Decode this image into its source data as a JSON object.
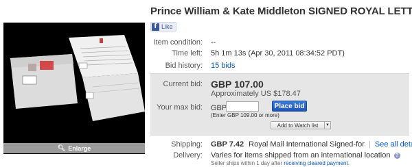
{
  "listing": {
    "title": "Prince William & Kate Middleton SIGNED ROYAL LETTER",
    "like_label": "Like",
    "like_icon": "facebook-icon"
  },
  "photo": {
    "enlarge_label": "Enlarge",
    "enlarge_icon": "magnifier-icon"
  },
  "details": {
    "item_condition_label": "Item condition:",
    "item_condition_value": "--",
    "time_left_label": "Time left:",
    "time_left_value": "5h 1m 13s (Apr 30, 2011 08:34:52 PDT)",
    "bid_history_label": "Bid history:",
    "bid_history_value": "15 bids"
  },
  "bidding": {
    "current_bid_label": "Current bid:",
    "current_bid_value": "GBP 107.00",
    "approx_value": "Approximately US $178.47",
    "max_bid_label": "Your max bid:",
    "currency_prefix": "GBP",
    "max_bid_input_value": "",
    "place_bid_label": "Place bid",
    "enter_hint": "(Enter GBP 109.00 or more)",
    "watch_list_label": "Add to Watch list",
    "watch_list_arrow": "▼"
  },
  "shipping": {
    "shipping_label": "Shipping:",
    "shipping_price": "GBP 7.42",
    "shipping_method": "Royal Mail International Signed-for",
    "separator": "|",
    "see_all_link": "See all details",
    "delivery_label": "Delivery:",
    "delivery_value": "Varies for items shipped from an international location",
    "help_icon": "?",
    "seller_ships_text": "Seller ships within 1 day after",
    "seller_ships_link": "receiving cleared payment",
    "seller_ships_suffix": "."
  },
  "colors": {
    "link": "#0654ba",
    "place_bid_button": "#2a66c8",
    "bid_box_bg": "#e6e6e6",
    "photo_bg": "#000000"
  }
}
